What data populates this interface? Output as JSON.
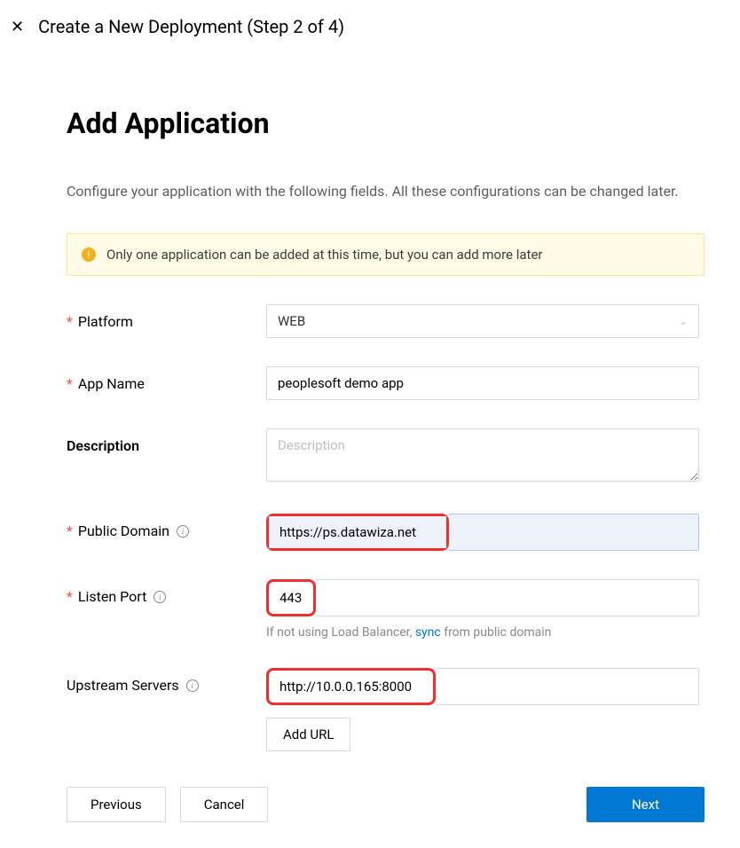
{
  "header": {
    "title": "Create a New Deployment (Step 2 of 4)"
  },
  "page": {
    "heading": "Add Application",
    "subtitle": "Configure your application with the following fields. All these configurations can be changed later."
  },
  "alert": {
    "text": "Only one application can be added at this time, but you can add more later"
  },
  "form": {
    "platform": {
      "label": "Platform",
      "value": "WEB"
    },
    "app_name": {
      "label": "App Name",
      "value": "peoplesoft demo app"
    },
    "description": {
      "label": "Description",
      "placeholder": "Description",
      "value": ""
    },
    "public_domain": {
      "label": "Public Domain",
      "value": "https://ps.datawiza.net"
    },
    "listen_port": {
      "label": "Listen Port",
      "value": "443",
      "hint_prefix": "If not using Load Balancer, ",
      "hint_link": "sync",
      "hint_suffix": " from public domain"
    },
    "upstream": {
      "label": "Upstream Servers",
      "value": "http://10.0.0.165:8000",
      "add_url_label": "Add URL"
    }
  },
  "buttons": {
    "previous": "Previous",
    "cancel": "Cancel",
    "next": "Next"
  }
}
